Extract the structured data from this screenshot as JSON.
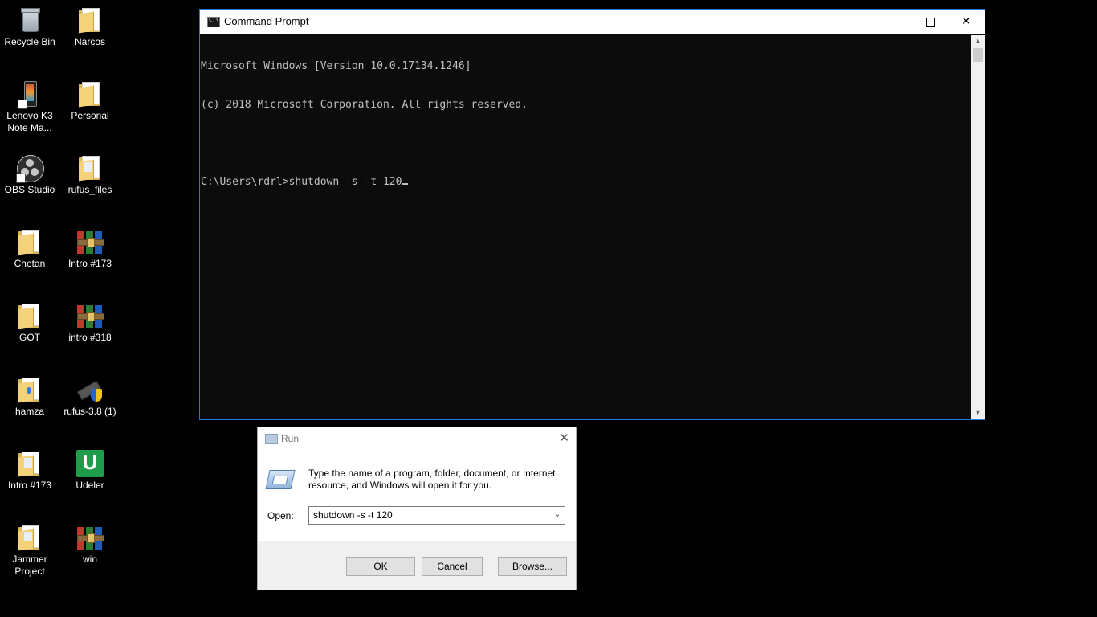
{
  "desktop": {
    "icons": [
      {
        "label": "Recycle Bin",
        "type": "recycle-bin"
      },
      {
        "label": "Narcos",
        "type": "folder"
      },
      {
        "label": "Lenovo K3 Note Ma...",
        "type": "phone"
      },
      {
        "label": "Personal",
        "type": "folder"
      },
      {
        "label": "OBS Studio",
        "type": "obs"
      },
      {
        "label": "rufus_files",
        "type": "folder"
      },
      {
        "label": "Chetan",
        "type": "folder"
      },
      {
        "label": "Intro #173",
        "type": "winrar-archive"
      },
      {
        "label": "GOT",
        "type": "folder"
      },
      {
        "label": "intro #318",
        "type": "winrar-archive"
      },
      {
        "label": "hamza",
        "type": "folder"
      },
      {
        "label": "rufus-3.8 (1)",
        "type": "rufus"
      },
      {
        "label": "Intro #173",
        "type": "folder"
      },
      {
        "label": "Udeler",
        "type": "udeler"
      },
      {
        "label": "Jammer Project",
        "type": "folder"
      },
      {
        "label": "win",
        "type": "winrar-archive"
      }
    ]
  },
  "cmd_window": {
    "title": "Command Prompt",
    "lines": [
      "Microsoft Windows [Version 10.0.17134.1246]",
      "(c) 2018 Microsoft Corporation. All rights reserved.",
      "",
      "C:\\Users\\rdrl>shutdown -s -t 120"
    ]
  },
  "run_dialog": {
    "title": "Run",
    "description": "Type the name of a program, folder, document, or Internet resource, and Windows will open it for you.",
    "open_label": "Open:",
    "open_value": "shutdown -s -t 120",
    "ok_label": "OK",
    "cancel_label": "Cancel",
    "browse_label": "Browse..."
  },
  "colors": {
    "desktop_bg": "#000000",
    "cmd_bg": "#0c0c0c",
    "cmd_text": "#c0c0c0",
    "window_border": "#2b79d6"
  }
}
